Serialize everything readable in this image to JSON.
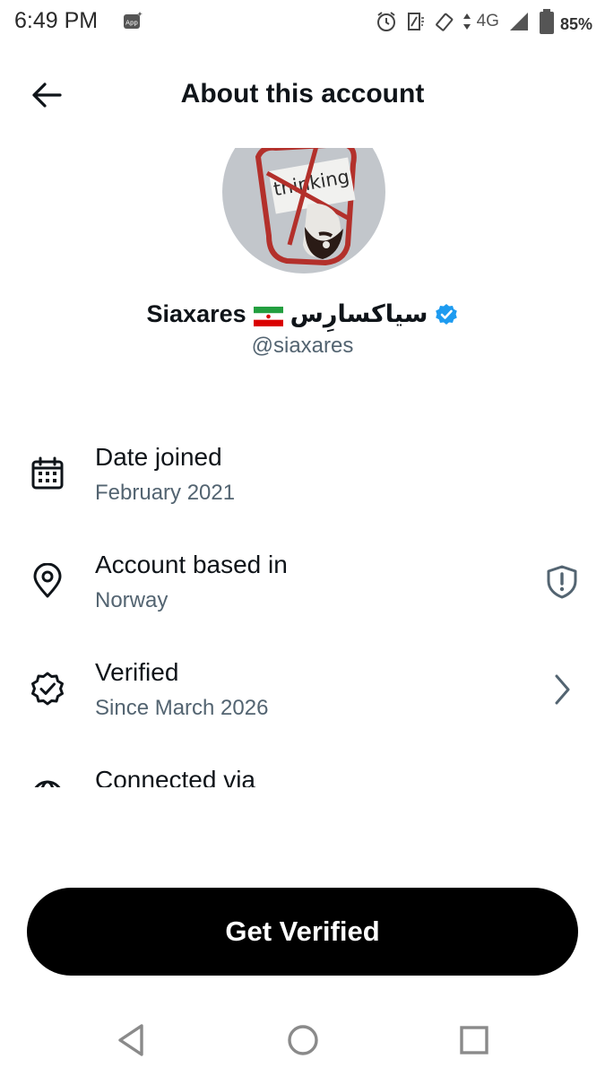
{
  "status_bar": {
    "time": "6:49 PM",
    "app_badge": "App",
    "network": "4G",
    "battery": "85%"
  },
  "header": {
    "title": "About this account",
    "back_icon": "arrow-left-icon"
  },
  "profile": {
    "avatar_text": "thinking",
    "display_name": "Siaxares",
    "display_name_fa": "سیاکسارِس",
    "flag": "iran-flag",
    "handle": "@siaxares",
    "verified_color": "#1d9bf0"
  },
  "info": [
    {
      "icon": "calendar-icon",
      "label": "Date joined",
      "value": "February 2021"
    },
    {
      "icon": "location-pin-icon",
      "label": "Account based in",
      "value": "Norway",
      "trailing_icon": "shield-alert-icon"
    },
    {
      "icon": "verified-badge-icon",
      "label": "Verified",
      "value": "Since March 2026",
      "trailing_icon": "chevron-right-icon"
    },
    {
      "icon": "globe-icon",
      "label": "Connected via"
    }
  ],
  "cta": {
    "label": "Get Verified"
  },
  "nav": [
    "back-triangle-icon",
    "home-circle-icon",
    "recents-square-icon"
  ],
  "colors": {
    "primary_text": "#0f1419",
    "secondary_text": "#536471",
    "cta_bg": "#000000"
  }
}
